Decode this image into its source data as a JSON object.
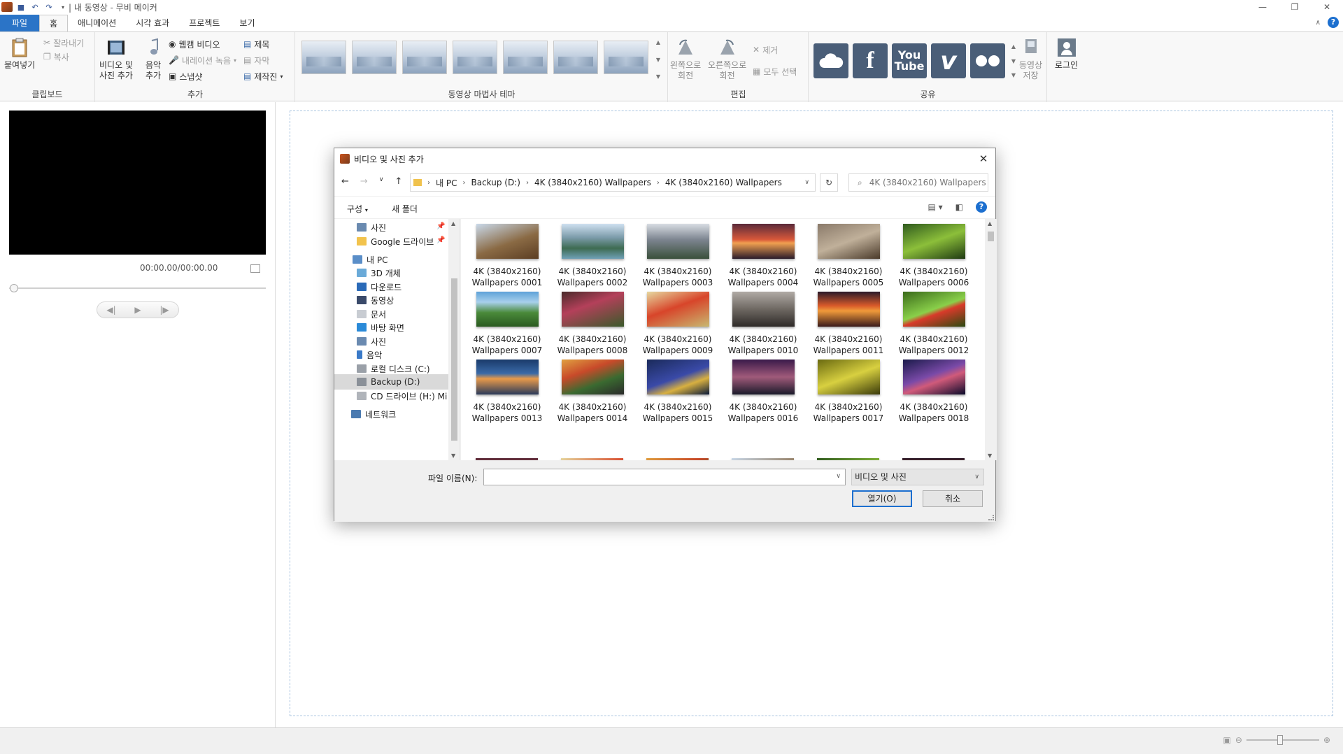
{
  "titlebar": {
    "title": "| 내 동영상 - 무비 메이커"
  },
  "tabs": [
    "파일",
    "홈",
    "애니메이션",
    "시각 효과",
    "프로젝트",
    "보기"
  ],
  "ribbon": {
    "clipboard": {
      "paste": "붙여넣기",
      "cut": "잘라내기",
      "copy": "복사",
      "group": "클립보드"
    },
    "add": {
      "video_photo_1": "비디오 및",
      "video_photo_2": "사진 추가",
      "music_1": "음악",
      "music_2": "추가",
      "webcam": "웹캠 비디오",
      "narration": "내레이션 녹음",
      "snapshot": "스냅샷",
      "title": "제목",
      "caption": "자막",
      "credits": "제작진",
      "group": "추가"
    },
    "themes": {
      "group": "동영상 마법사 테마"
    },
    "edit": {
      "rotate_left_1": "왼쪽으로",
      "rotate_left_2": "회전",
      "rotate_right_1": "오른쪽으로",
      "rotate_right_2": "회전",
      "remove": "제거",
      "select_all": "모두 선택",
      "group": "편집"
    },
    "share": {
      "youtube_1": "You",
      "youtube_2": "Tube",
      "vimeo": "v",
      "save_1": "동영상",
      "save_2": "저장",
      "group": "공유"
    },
    "login": "로그인"
  },
  "preview": {
    "timecode": "00:00.00/00:00.00"
  },
  "dialog": {
    "title": "비디오 및 사진 추가",
    "breadcrumb": [
      "내 PC",
      "Backup (D:)",
      "4K (3840x2160) Wallpapers",
      "4K (3840x2160) Wallpapers"
    ],
    "search_placeholder": "4K (3840x2160) Wallpapers ...",
    "organize": "구성",
    "new_folder": "새 폴더",
    "nav": [
      {
        "label": "사진",
        "pinned": true
      },
      {
        "label": "Google 드라이브",
        "pinned": true
      },
      {
        "label": "내 PC"
      },
      {
        "label": "3D 개체"
      },
      {
        "label": "다운로드"
      },
      {
        "label": "동영상"
      },
      {
        "label": "문서"
      },
      {
        "label": "바탕 화면"
      },
      {
        "label": "사진"
      },
      {
        "label": "음악"
      },
      {
        "label": "로컬 디스크 (C:)"
      },
      {
        "label": "Backup (D:)"
      },
      {
        "label": "CD 드라이브 (H:) Mi"
      },
      {
        "label": "네트워크"
      }
    ],
    "files": [
      {
        "line1": "4K (3840x2160)",
        "line2": "Wallpapers 0001"
      },
      {
        "line1": "4K (3840x2160)",
        "line2": "Wallpapers 0002"
      },
      {
        "line1": "4K (3840x2160)",
        "line2": "Wallpapers 0003"
      },
      {
        "line1": "4K (3840x2160)",
        "line2": "Wallpapers 0004"
      },
      {
        "line1": "4K (3840x2160)",
        "line2": "Wallpapers 0005"
      },
      {
        "line1": "4K (3840x2160)",
        "line2": "Wallpapers 0006"
      },
      {
        "line1": "4K (3840x2160)",
        "line2": "Wallpapers 0007"
      },
      {
        "line1": "4K (3840x2160)",
        "line2": "Wallpapers 0008"
      },
      {
        "line1": "4K (3840x2160)",
        "line2": "Wallpapers 0009"
      },
      {
        "line1": "4K (3840x2160)",
        "line2": "Wallpapers 0010"
      },
      {
        "line1": "4K (3840x2160)",
        "line2": "Wallpapers 0011"
      },
      {
        "line1": "4K (3840x2160)",
        "line2": "Wallpapers 0012"
      },
      {
        "line1": "4K (3840x2160)",
        "line2": "Wallpapers 0013"
      },
      {
        "line1": "4K (3840x2160)",
        "line2": "Wallpapers 0014"
      },
      {
        "line1": "4K (3840x2160)",
        "line2": "Wallpapers 0015"
      },
      {
        "line1": "4K (3840x2160)",
        "line2": "Wallpapers 0016"
      },
      {
        "line1": "4K (3840x2160)",
        "line2": "Wallpapers 0017"
      },
      {
        "line1": "4K (3840x2160)",
        "line2": "Wallpapers 0018"
      }
    ],
    "filename_label": "파일 이름(N):",
    "filename_value": "",
    "filetype": "비디오 및 사진",
    "open_button": "열기(O)",
    "cancel_button": "취소"
  },
  "colors": {
    "accent": "#2b74c7",
    "thumbs": [
      "linear-gradient(160deg,#c9d9ea,#8a6a44 55%,#5b3d22)",
      "linear-gradient(180deg,#cfe0f0,#7a9aa8 40%,#3e6b52 70%,#6fa0b6)",
      "linear-gradient(180deg,#d8dde3,#7d8590 45%,#3a4f3b)",
      "linear-gradient(180deg,#5a2a3a,#d8583a 45%,#f1a050 55%,#2a1c2a)",
      "linear-gradient(160deg,#8a7a6a,#c0b09a 50%,#4a3a2a)",
      "linear-gradient(160deg,#2f5a1e,#8cbf3a 50%,#1f3a12)",
      "linear-gradient(180deg,#5ea2d8,#a8d0ec 30%,#4a8a3a 60%,#2a5a20)",
      "linear-gradient(160deg,#4a2a2a,#b4405a 40%,#3a5a2a)",
      "linear-gradient(160deg,#e6d8a0,#d8452a 45%,#c8b870)",
      "linear-gradient(180deg,#b0aaa5,#6e6862 50%,#2e2a28)",
      "linear-gradient(180deg,#2a1a2a,#d85a2a 40%,#f09a3a 55%,#3a1a1a)",
      "linear-gradient(160deg,#3a6a1a,#8ad04a 50%,#d83a2a 60%,#2a4a10)",
      "linear-gradient(180deg,#1a3a6a,#3a6aa8 40%,#e89a4a 55%,#2a3a5a)",
      "linear-gradient(160deg,#e0a040,#c84a2a 35%,#3a6a30 65%,#2a2a2a)",
      "linear-gradient(160deg,#1a2a5a,#3a4aa8 50%,#d8b040 70%,#0a1a3a)",
      "linear-gradient(180deg,#3a1a4a,#a05a7a 50%,#1a1a2a)",
      "linear-gradient(160deg,#6a6a10,#d8d040 50%,#3a3a0a)",
      "linear-gradient(160deg,#1a1a4a,#7a4aa8 45%,#d05a7a 60%,#0a0a2a)"
    ]
  }
}
